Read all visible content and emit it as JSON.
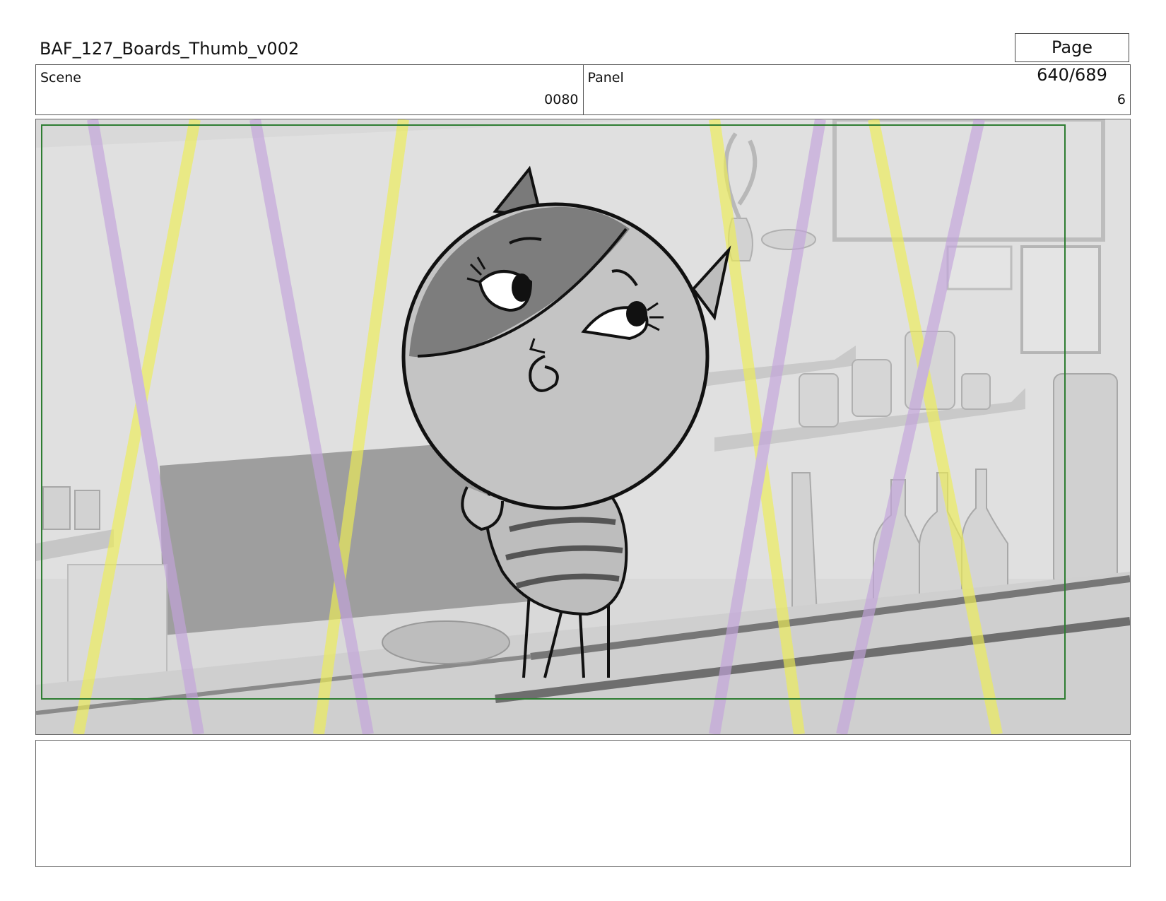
{
  "header": {
    "title": "BAF_127_Boards_Thumb_v002",
    "page": "Page 640/689"
  },
  "info": {
    "scene_label": "Scene",
    "scene_value": "0080",
    "panel_label": "Panel",
    "panel_value": "6"
  },
  "panel": {
    "safe_frame_color": "#2e7d32",
    "light_colors": {
      "yellow": "#eeee55",
      "purple": "#c3a4dc"
    }
  },
  "notes": {
    "text": ""
  }
}
